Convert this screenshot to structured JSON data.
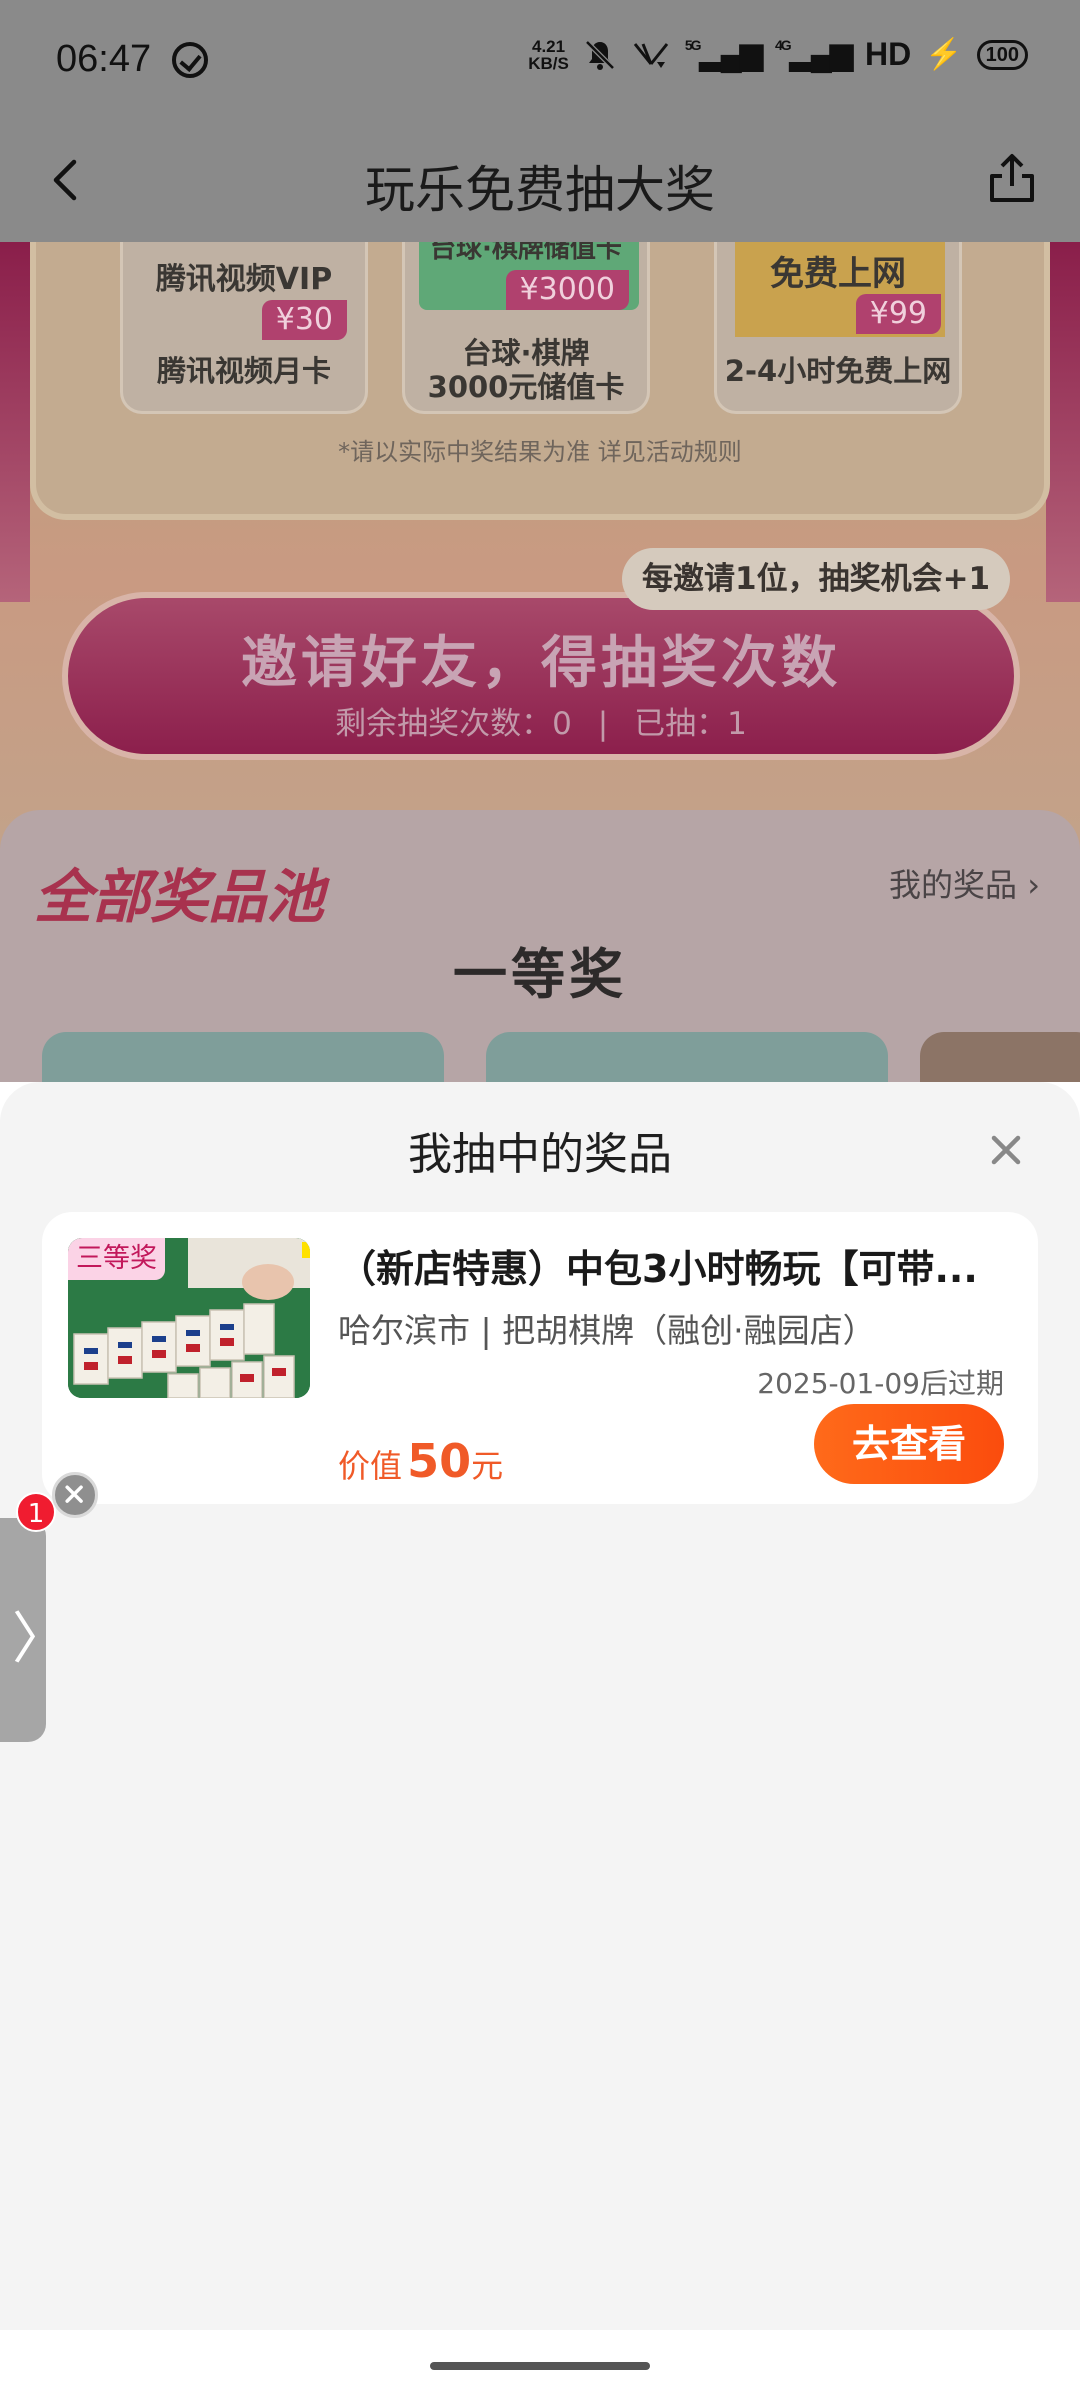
{
  "status_bar": {
    "time": "06:47",
    "net_speed_value": "4.21",
    "net_speed_unit": "KB/S",
    "signal_1": "5G",
    "signal_2": "4G",
    "hd": "HD",
    "battery": "100"
  },
  "header": {
    "title": "玩乐免费抽大奖"
  },
  "background_page": {
    "prizes": [
      {
        "title": "腾讯视频VIP",
        "tag": "¥30",
        "desc": "腾讯视频月卡"
      },
      {
        "title": "台球·棋牌储值卡",
        "tag": "¥3000",
        "desc": "台球·棋牌\n3000元储值卡"
      },
      {
        "title": "免费上网",
        "tag": "¥99",
        "desc": "2-4小时免费上网"
      }
    ],
    "note": "*请以实际中奖结果为准 详见活动规则",
    "invite_tip": "每邀请1位，抽奖机会+1",
    "invite_button": "邀请好友，得抽奖次数",
    "remaining_draws": "剩余抽奖次数：0",
    "drawn": "已抽：1",
    "pool_title": "全部奖品池",
    "my_prizes": "我的奖品",
    "first_prize": "一等奖"
  },
  "sheet": {
    "title": "我抽中的奖品",
    "item": {
      "badge": "三等奖",
      "title": "（新店特惠）中包3小时畅玩【可带...",
      "shop": "哈尔滨市 | 把胡棋牌（融创·融园店）",
      "expire": "2025-01-09后过期",
      "value_label": "价值",
      "value_num": "50",
      "value_unit": "元",
      "button": "去查看"
    }
  },
  "float_widget": {
    "badge": "1",
    "arrow": "〉"
  },
  "colors": {
    "accent_orange": "#fb4c0d",
    "value_red": "#f05a28",
    "badge_red": "#f01c30"
  }
}
